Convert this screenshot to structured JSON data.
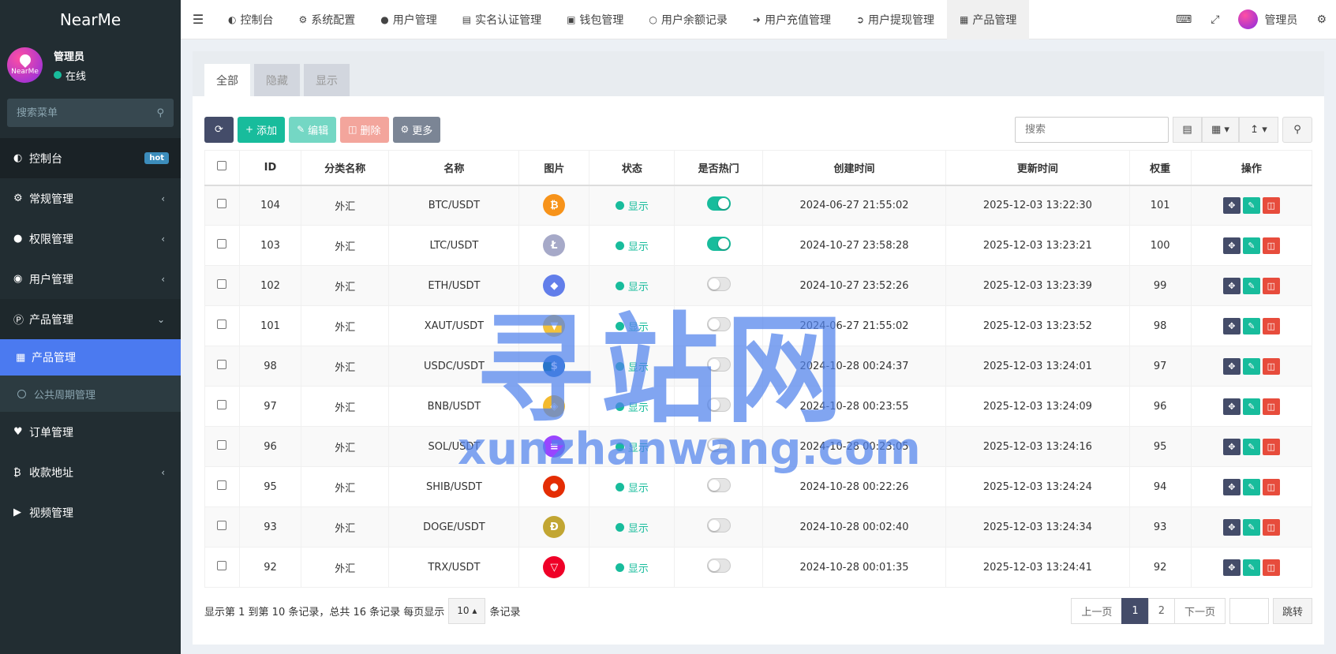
{
  "app": {
    "logo": "NearMe"
  },
  "user": {
    "name": "管理员",
    "status": "在线",
    "avatar_text": "NearMe"
  },
  "sidebar": {
    "search_placeholder": "搜索菜单",
    "items": [
      {
        "label": "控制台",
        "icon": "dashboard-icon",
        "badge": "hot"
      },
      {
        "label": "常规管理",
        "icon": "cogs-icon"
      },
      {
        "label": "权限管理",
        "icon": "group-icon"
      },
      {
        "label": "用户管理",
        "icon": "user-circle-icon"
      },
      {
        "label": "产品管理",
        "icon": "product-icon"
      },
      {
        "label": "产品管理",
        "icon": "bag-icon"
      },
      {
        "label": "公共周期管理",
        "icon": "circle-icon"
      },
      {
        "label": "订单管理",
        "icon": "heartbeat-icon"
      },
      {
        "label": "收款地址",
        "icon": "bitcoin-icon"
      },
      {
        "label": "视频管理",
        "icon": "video-icon"
      }
    ]
  },
  "topnav": {
    "tabs": [
      {
        "label": "控制台",
        "icon": "dashboard-icon"
      },
      {
        "label": "系统配置",
        "icon": "gear-icon"
      },
      {
        "label": "用户管理",
        "icon": "user-icon"
      },
      {
        "label": "实名认证管理",
        "icon": "id-card-icon"
      },
      {
        "label": "钱包管理",
        "icon": "money-icon"
      },
      {
        "label": "用户余额记录",
        "icon": "circle-icon"
      },
      {
        "label": "用户充值管理",
        "icon": "sign-in-icon"
      },
      {
        "label": "用户提现管理",
        "icon": "sign-out-icon"
      },
      {
        "label": "产品管理",
        "icon": "bag-icon"
      }
    ],
    "admin": "管理员"
  },
  "filter_tabs": [
    "全部",
    "隐藏",
    "显示"
  ],
  "toolbar": {
    "add": "添加",
    "edit": "编辑",
    "delete": "删除",
    "more": "更多",
    "search_placeholder": "搜索"
  },
  "table": {
    "columns": [
      "ID",
      "分类名称",
      "名称",
      "图片",
      "状态",
      "是否热门",
      "创建时间",
      "更新时间",
      "权重",
      "操作"
    ],
    "rows": [
      {
        "id": "104",
        "category": "外汇",
        "name": "BTC/USDT",
        "coin_icon": "bitcoin-icon",
        "coin_color": "#f7931a",
        "coin_glyph": "₿",
        "status": "显示",
        "hot": true,
        "created": "2024-06-27 21:55:02",
        "updated": "2025-12-03 13:22:30",
        "weight": "101"
      },
      {
        "id": "103",
        "category": "外汇",
        "name": "LTC/USDT",
        "coin_icon": "litecoin-icon",
        "coin_color": "#a6a9c8",
        "coin_glyph": "Ł",
        "status": "显示",
        "hot": true,
        "created": "2024-10-27 23:58:28",
        "updated": "2025-12-03 13:23:21",
        "weight": "100"
      },
      {
        "id": "102",
        "category": "外汇",
        "name": "ETH/USDT",
        "coin_icon": "ethereum-icon",
        "coin_color": "#627eea",
        "coin_glyph": "◆",
        "status": "显示",
        "hot": false,
        "created": "2024-10-27 23:52:26",
        "updated": "2025-12-03 13:23:39",
        "weight": "99"
      },
      {
        "id": "101",
        "category": "外汇",
        "name": "XAUT/USDT",
        "coin_icon": "gold-icon",
        "coin_color": "#f3c23c",
        "coin_glyph": "▼",
        "status": "显示",
        "hot": false,
        "created": "2024-06-27 21:55:02",
        "updated": "2025-12-03 13:23:52",
        "weight": "98"
      },
      {
        "id": "98",
        "category": "外汇",
        "name": "USDC/USDT",
        "coin_icon": "usdc-icon",
        "coin_color": "#2775ca",
        "coin_glyph": "$",
        "status": "显示",
        "hot": false,
        "created": "2024-10-28 00:24:37",
        "updated": "2025-12-03 13:24:01",
        "weight": "97"
      },
      {
        "id": "97",
        "category": "外汇",
        "name": "BNB/USDT",
        "coin_icon": "bnb-icon",
        "coin_color": "#f3ba2f",
        "coin_glyph": "◈",
        "status": "显示",
        "hot": false,
        "created": "2024-10-28 00:23:55",
        "updated": "2025-12-03 13:24:09",
        "weight": "96"
      },
      {
        "id": "96",
        "category": "外汇",
        "name": "SOL/USDT",
        "coin_icon": "solana-icon",
        "coin_color": "#9945ff",
        "coin_glyph": "≡",
        "status": "显示",
        "hot": false,
        "created": "2024-10-28 00:23:05",
        "updated": "2025-12-03 13:24:16",
        "weight": "95"
      },
      {
        "id": "95",
        "category": "外汇",
        "name": "SHIB/USDT",
        "coin_icon": "shiba-icon",
        "coin_color": "#e42d04",
        "coin_glyph": "●",
        "status": "显示",
        "hot": false,
        "created": "2024-10-28 00:22:26",
        "updated": "2025-12-03 13:24:24",
        "weight": "94"
      },
      {
        "id": "93",
        "category": "外汇",
        "name": "DOGE/USDT",
        "coin_icon": "doge-icon",
        "coin_color": "#c2a633",
        "coin_glyph": "Ð",
        "status": "显示",
        "hot": false,
        "created": "2024-10-28 00:02:40",
        "updated": "2025-12-03 13:24:34",
        "weight": "93"
      },
      {
        "id": "92",
        "category": "外汇",
        "name": "TRX/USDT",
        "coin_icon": "tron-icon",
        "coin_color": "#ef0027",
        "coin_glyph": "▽",
        "status": "显示",
        "hot": false,
        "created": "2024-10-28 00:01:35",
        "updated": "2025-12-03 13:24:41",
        "weight": "92"
      }
    ]
  },
  "footer": {
    "summary": "显示第 1 到第 10 条记录，总共 16 条记录 每页显示",
    "page_size": "10",
    "suffix": "条记录",
    "prev": "上一页",
    "pages": [
      "1",
      "2"
    ],
    "current_page": "1",
    "next": "下一页",
    "jump": "跳转"
  },
  "watermark": {
    "big": "寻站网",
    "small": "xunzhanwang.com"
  },
  "colors": {
    "accent": "#18bc9c",
    "sidebar": "#222d32",
    "active_menu": "#4b7af0",
    "danger": "#e74c3c",
    "primary_dark": "#444c69"
  }
}
